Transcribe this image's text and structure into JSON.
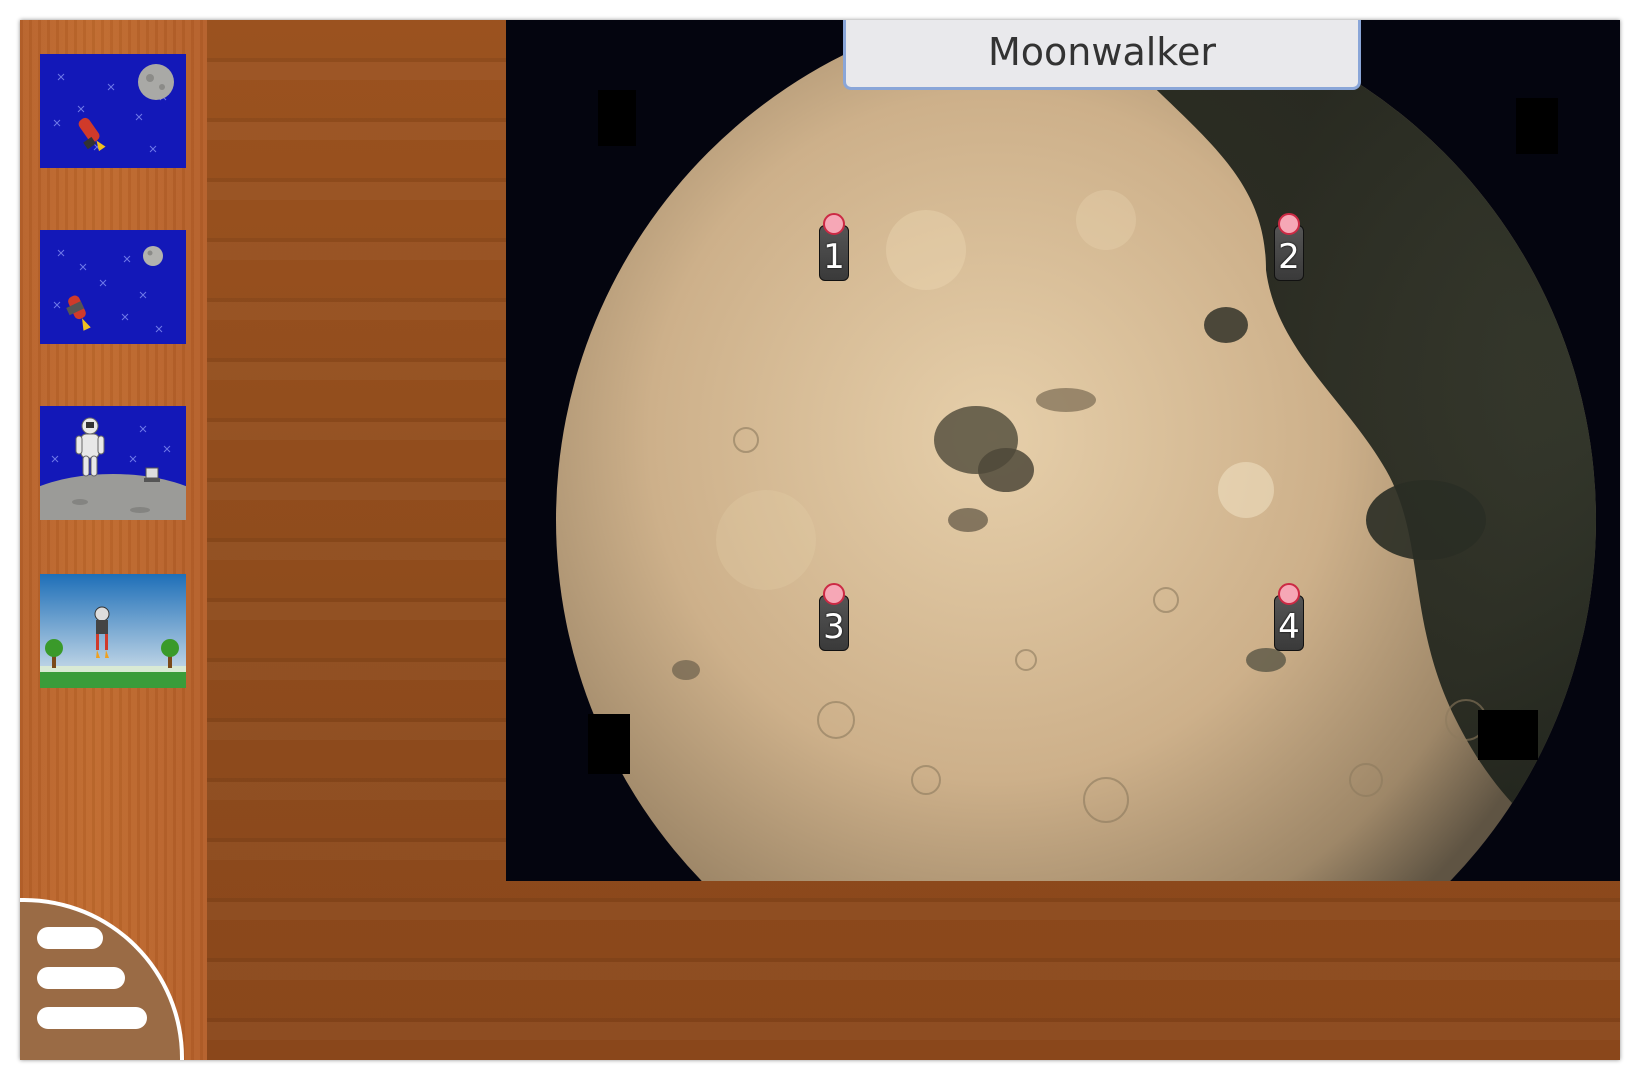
{
  "title": "Moonwalker",
  "sidebar": {
    "thumbnails": [
      {
        "name": "rocket-to-moon-thumbnail"
      },
      {
        "name": "rocket-near-moon-thumbnail"
      },
      {
        "name": "astronaut-on-moon-thumbnail"
      },
      {
        "name": "rocket-launch-thumbnail"
      }
    ]
  },
  "hotspots": [
    {
      "label": "1"
    },
    {
      "label": "2"
    },
    {
      "label": "3"
    },
    {
      "label": "4"
    }
  ],
  "menu": {
    "icon": "hamburger-menu-icon"
  },
  "colors": {
    "wood": "#8b4a1c",
    "sidebar_wood": "#bc652b",
    "title_border": "#8aa6d8",
    "pin": "#f6a7b6",
    "space": "#04050f"
  }
}
